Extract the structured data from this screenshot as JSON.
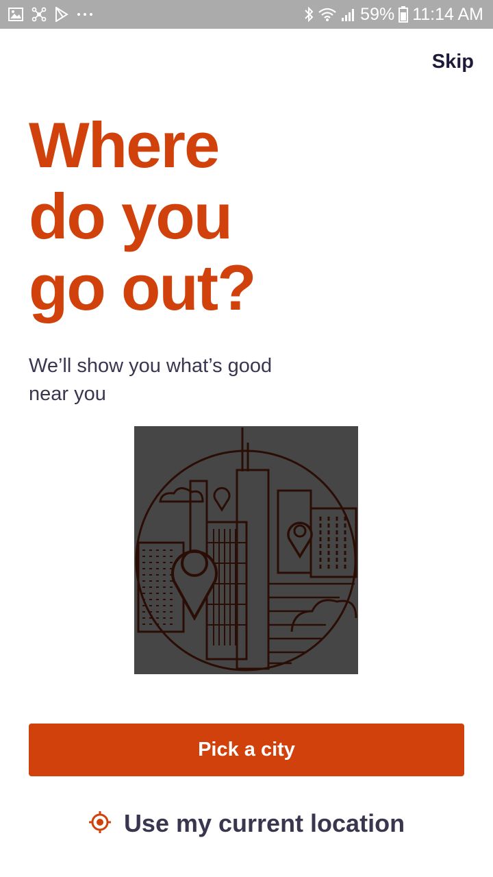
{
  "status_bar": {
    "battery_percent": "59%",
    "time": "11:14 AM",
    "left_icons": [
      "gallery-icon",
      "network-icon",
      "play-store-icon",
      "more-dots-icon"
    ],
    "right_icons": [
      "bluetooth-icon",
      "wifi-icon",
      "signal-icon",
      "battery-icon"
    ]
  },
  "header": {
    "skip_label": "Skip"
  },
  "main": {
    "headline": "Where\ndo you\ngo out?",
    "subtitle": "We’ll show you what’s good near you",
    "illustration_icon": "city-skyline-illustration"
  },
  "actions": {
    "pick_city_label": "Pick a city",
    "current_location_label": "Use my current location",
    "current_location_icon": "target-location-icon"
  },
  "colors": {
    "accent": "#d1410c",
    "text_dark": "#39364f",
    "status_bar": "#ababab",
    "illustration_bg": "#464646"
  }
}
